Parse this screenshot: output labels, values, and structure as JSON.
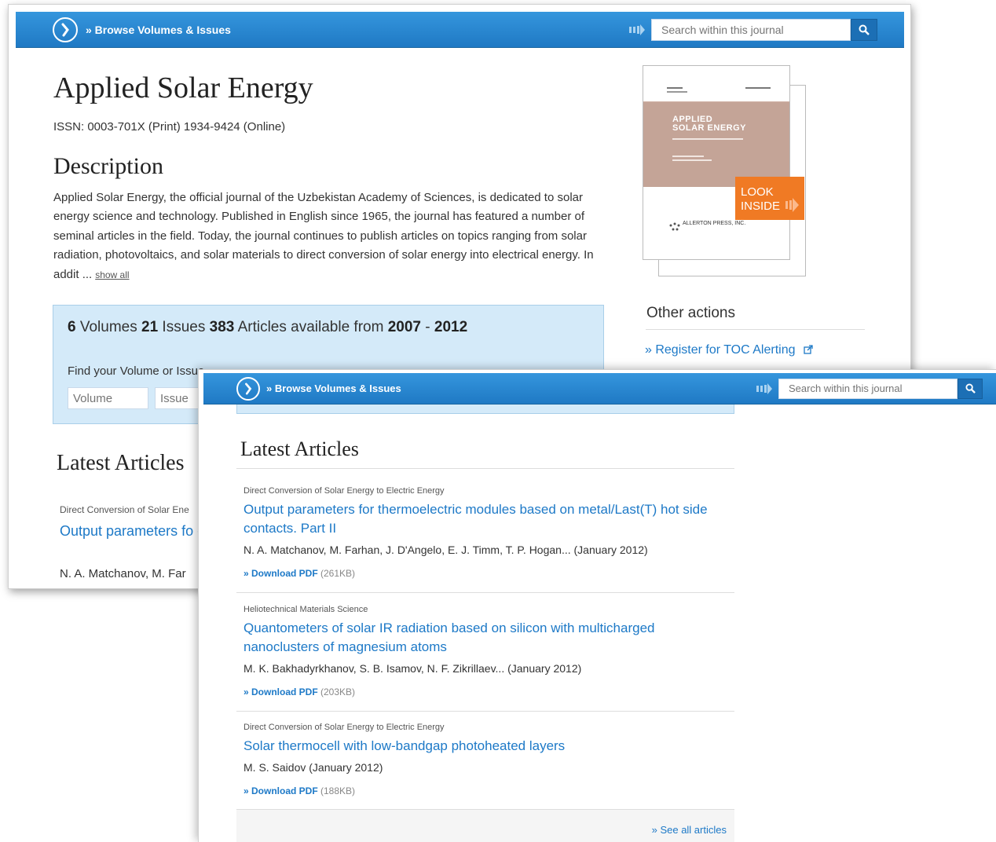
{
  "header": {
    "browse_label": "» Browse Volumes & Issues",
    "search_placeholder": "Search within this journal"
  },
  "journal": {
    "title": "Applied Solar Energy",
    "issn": "ISSN: 0003-701X (Print) 1934-9424 (Online)"
  },
  "description": {
    "heading": "Description",
    "text": "Applied Solar Energy, the official journal of the Uzbekistan Academy of Sciences, is dedicated to solar energy science and technology. Published in English since 1965, the journal has featured a number of seminal articles in the field. Today, the journal continues to publish articles on topics ranging from solar radiation, photovoltaics, and solar materials to direct conversion of solar energy into electrical energy. In addit ...",
    "show_all": "show all"
  },
  "volumes_box": {
    "volumes_count": "6",
    "volumes_label": " Volumes ",
    "issues_count": "21",
    "issues_label": " Issues ",
    "articles_count": "383",
    "articles_label": " Articles available from ",
    "year_from": "2007",
    "dash": " - ",
    "year_to": "2012",
    "find_label": "Find your Volume or Issue",
    "volume_placeholder": "Volume",
    "issue_placeholder": "Issue"
  },
  "cover": {
    "title_line1": "APPLIED",
    "title_line2": "SOLAR ENERGY",
    "look_inside_line1": "LOOK",
    "look_inside_line2": "INSIDE",
    "publisher": "ALLERTON PRESS, INC."
  },
  "other_actions": {
    "heading": "Other actions",
    "items": [
      "» Register for TOC Alerting"
    ]
  },
  "latest": {
    "heading": "Latest Articles",
    "articles": [
      {
        "category": "Direct Conversion of Solar Energy to Electric Energy",
        "title": "Output parameters for thermoelectric modules based on metal/Last(T) hot side contacts. Part II",
        "authors": "N. A. Matchanov, M. Farhan, J. D'Angelo, E. J. Timm, T. P. Hogan... (January 2012)",
        "download": "» Download PDF",
        "size": " (261KB)"
      },
      {
        "category": "Heliotechnical Materials Science",
        "title": "Quantometers of solar IR radiation based on silicon with multicharged nanoclusters of magnesium atoms",
        "authors": "M. K. Bakhadyrkhanov, S. B. Isamov, N. F. Zikrillaev... (January 2012)",
        "download": "» Download PDF",
        "size": " (203KB)"
      },
      {
        "category": "Direct Conversion of Solar Energy to Electric Energy",
        "title": "Solar thermocell with low-bandgap photoheated layers",
        "authors": "M. S. Saidov (January 2012)",
        "download": "» Download PDF",
        "size": " (188KB)"
      }
    ],
    "see_all": "» See all articles"
  },
  "background_window_preview": {
    "category": "Direct Conversion of Solar Ene",
    "title": "Output parameters fo contacts. Part II",
    "authors": "N. A. Matchanov, M. Far"
  },
  "colors": {
    "header_blue": "#1f79c4",
    "link_blue": "#1d79c7",
    "panel_blue": "#d4eaf9",
    "look_inside_orange": "#f07a24"
  }
}
